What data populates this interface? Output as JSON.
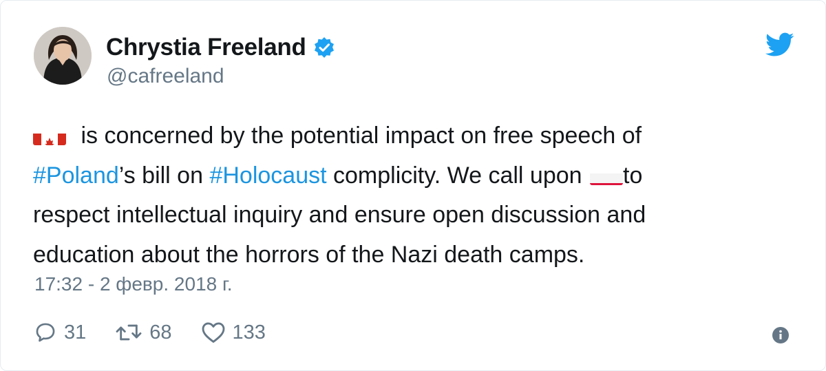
{
  "user": {
    "name": "Chrystia Freeland",
    "handle": "@cafreeland",
    "avatar_icon": "profile-photo"
  },
  "tweet": {
    "flag_canada": "canada-flag-emoji",
    "line1_text": " is concerned by the potential impact on free speech of",
    "hashtag_poland": "#Poland",
    "line2_mid": "’s bill on ",
    "hashtag_holocaust": "#Holocaust",
    "line2_end": " complicity. We call upon ",
    "flag_poland": "poland-flag-emoji",
    "line2_after_flag": "to",
    "line3": "respect intellectual inquiry and ensure open discussion and",
    "line4": "education about the horrors of the Nazi death camps."
  },
  "timestamp": "17:32 - 2 февр. 2018 г.",
  "actions": {
    "replies": "31",
    "retweets": "68",
    "likes": "133"
  },
  "colors": {
    "hashtag": "#1b95e0",
    "twitter_blue": "#1da1f2",
    "muted": "#657786",
    "text": "#14171a"
  }
}
